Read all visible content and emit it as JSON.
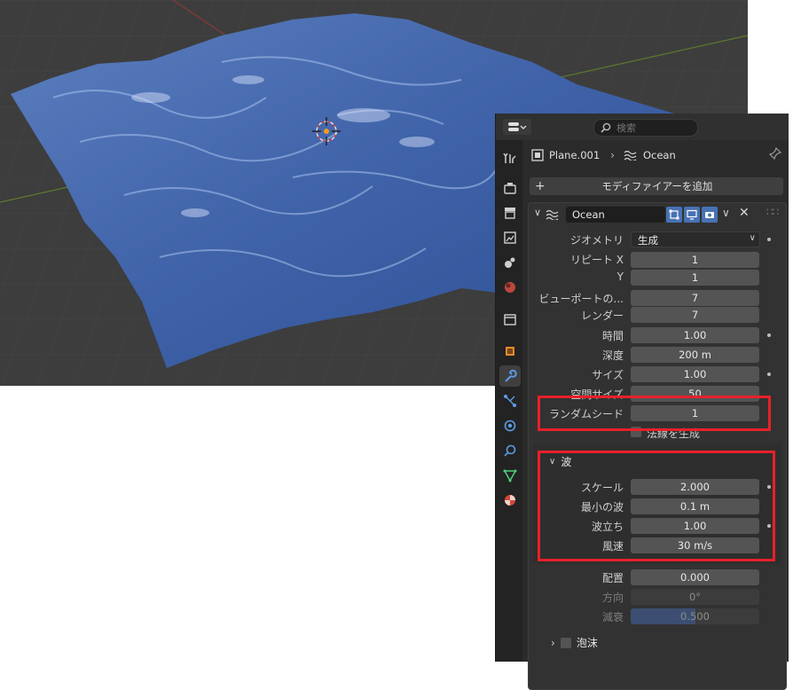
{
  "header": {
    "search_placeholder": "検索"
  },
  "breadcrumb": {
    "object": "Plane.001",
    "modifier": "Ocean"
  },
  "add_modifier_label": "モディファイアーを追加",
  "modifier": {
    "name": "Ocean"
  },
  "properties": {
    "geometry_label": "ジオメトリ",
    "geometry_value": "生成",
    "repeat_x_label": "リピート X",
    "repeat_x_value": "1",
    "repeat_y_label": "Y",
    "repeat_y_value": "1",
    "viewport_res_label": "ビューポートの...",
    "viewport_res_value": "7",
    "render_res_label": "レンダー",
    "render_res_value": "7",
    "time_label": "時間",
    "time_value": "1.00",
    "depth_label": "深度",
    "depth_value": "200 m",
    "size_label": "サイズ",
    "size_value": "1.00",
    "spatial_size_label": "空間サイズ",
    "spatial_size_value": "50",
    "random_seed_label": "ランダムシード",
    "random_seed_value": "1",
    "generate_normals_label": "法線を生成"
  },
  "waves": {
    "section_label": "波",
    "scale_label": "スケール",
    "scale_value": "2.000",
    "min_wave_label": "最小の波",
    "min_wave_value": "0.1 m",
    "choppiness_label": "波立ち",
    "choppiness_value": "1.00",
    "wind_label": "風速",
    "wind_value": "30 m/s",
    "alignment_label": "配置",
    "alignment_value": "0.000",
    "direction_label": "方向",
    "direction_value": "0°",
    "damping_label": "減衰",
    "damping_value": "0.500",
    "damping_fraction": 0.5
  },
  "foam": {
    "section_label": "泡沫"
  },
  "colors": {
    "highlight_box": "#e8202a",
    "accent_blue": "#4772b3",
    "ocean_blue": "#3f62a8"
  }
}
